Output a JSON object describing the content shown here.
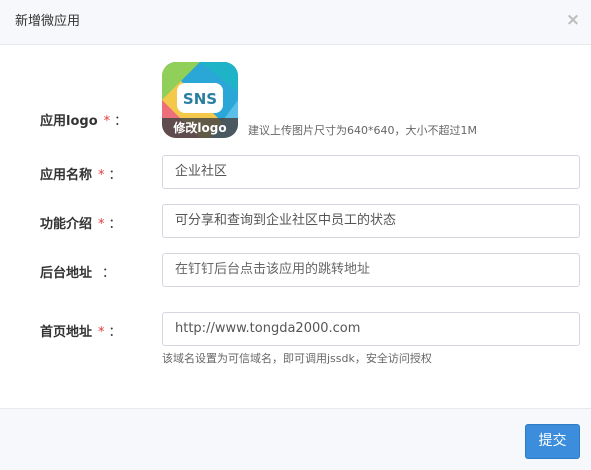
{
  "dialog": {
    "title": "新增微应用",
    "close_icon": "×"
  },
  "form": {
    "logo": {
      "label": "应用logo",
      "required_mark": "*",
      "colon": "：",
      "icon_text": "SNS",
      "change_label": "修改logo",
      "hint": "建议上传图片尺寸为640*640，大小不超过1M"
    },
    "name": {
      "label": "应用名称",
      "required_mark": "*",
      "colon": "：",
      "value": "企业社区"
    },
    "intro": {
      "label": "功能介绍",
      "required_mark": "*",
      "colon": "：",
      "value": "可分享和查询到企业社区中员工的状态"
    },
    "backend": {
      "label": "后台地址",
      "colon": "：",
      "placeholder": "在钉钉后台点击该应用的跳转地址"
    },
    "homepage": {
      "label": "首页地址",
      "required_mark": "*",
      "colon": "：",
      "value": "http://www.tongda2000.com",
      "help": "该域名设置为可信域名，即可调用jssdk，安全访问授权"
    }
  },
  "footer": {
    "submit_label": "提交"
  },
  "colors": {
    "accent": "#3c8ddc",
    "required": "#e13b3b"
  }
}
